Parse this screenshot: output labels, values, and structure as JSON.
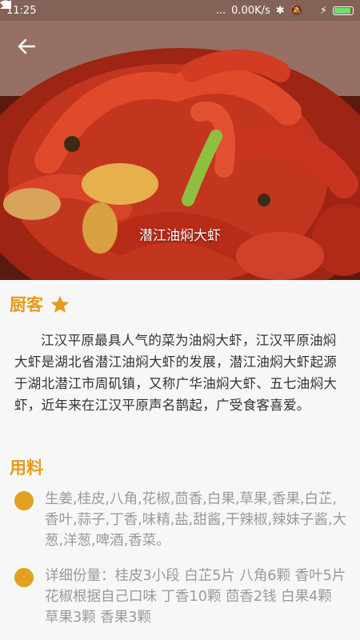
{
  "status": {
    "time": "11:25",
    "dots": "...",
    "speed": "0.00K/s"
  },
  "hero": {
    "title": "潜江油焖大虾"
  },
  "chef": {
    "label": "厨客",
    "description": "江汉平原最具人气的菜为油焖大虾，江汉平原油焖大虾是湖北省潜江油焖大虾的发展，潜江油焖大虾起源于湖北潜江市周矶镇，又称广华油焖大虾、五七油焖大虾，近年来在江汉平原声名鹊起，广受食客喜爱。"
  },
  "ingredients": {
    "label": "用料",
    "items": [
      "生姜,桂皮,八角,花椒,茴香,白果,草果,香果,白芷,香叶,蒜子,丁香,味精,盐,甜酱,干辣椒,辣妹子酱,大葱,洋葱,啤酒,香菜。",
      "详细份量：桂皮3小段 白芷5片 八角6颗 香叶5片 花椒根据自己口味 丁香10颗 茴香2钱 白果4颗 草果3颗 香果3颗"
    ]
  },
  "colors": {
    "accent": "#e79a1a",
    "dot": "#e3a021"
  }
}
